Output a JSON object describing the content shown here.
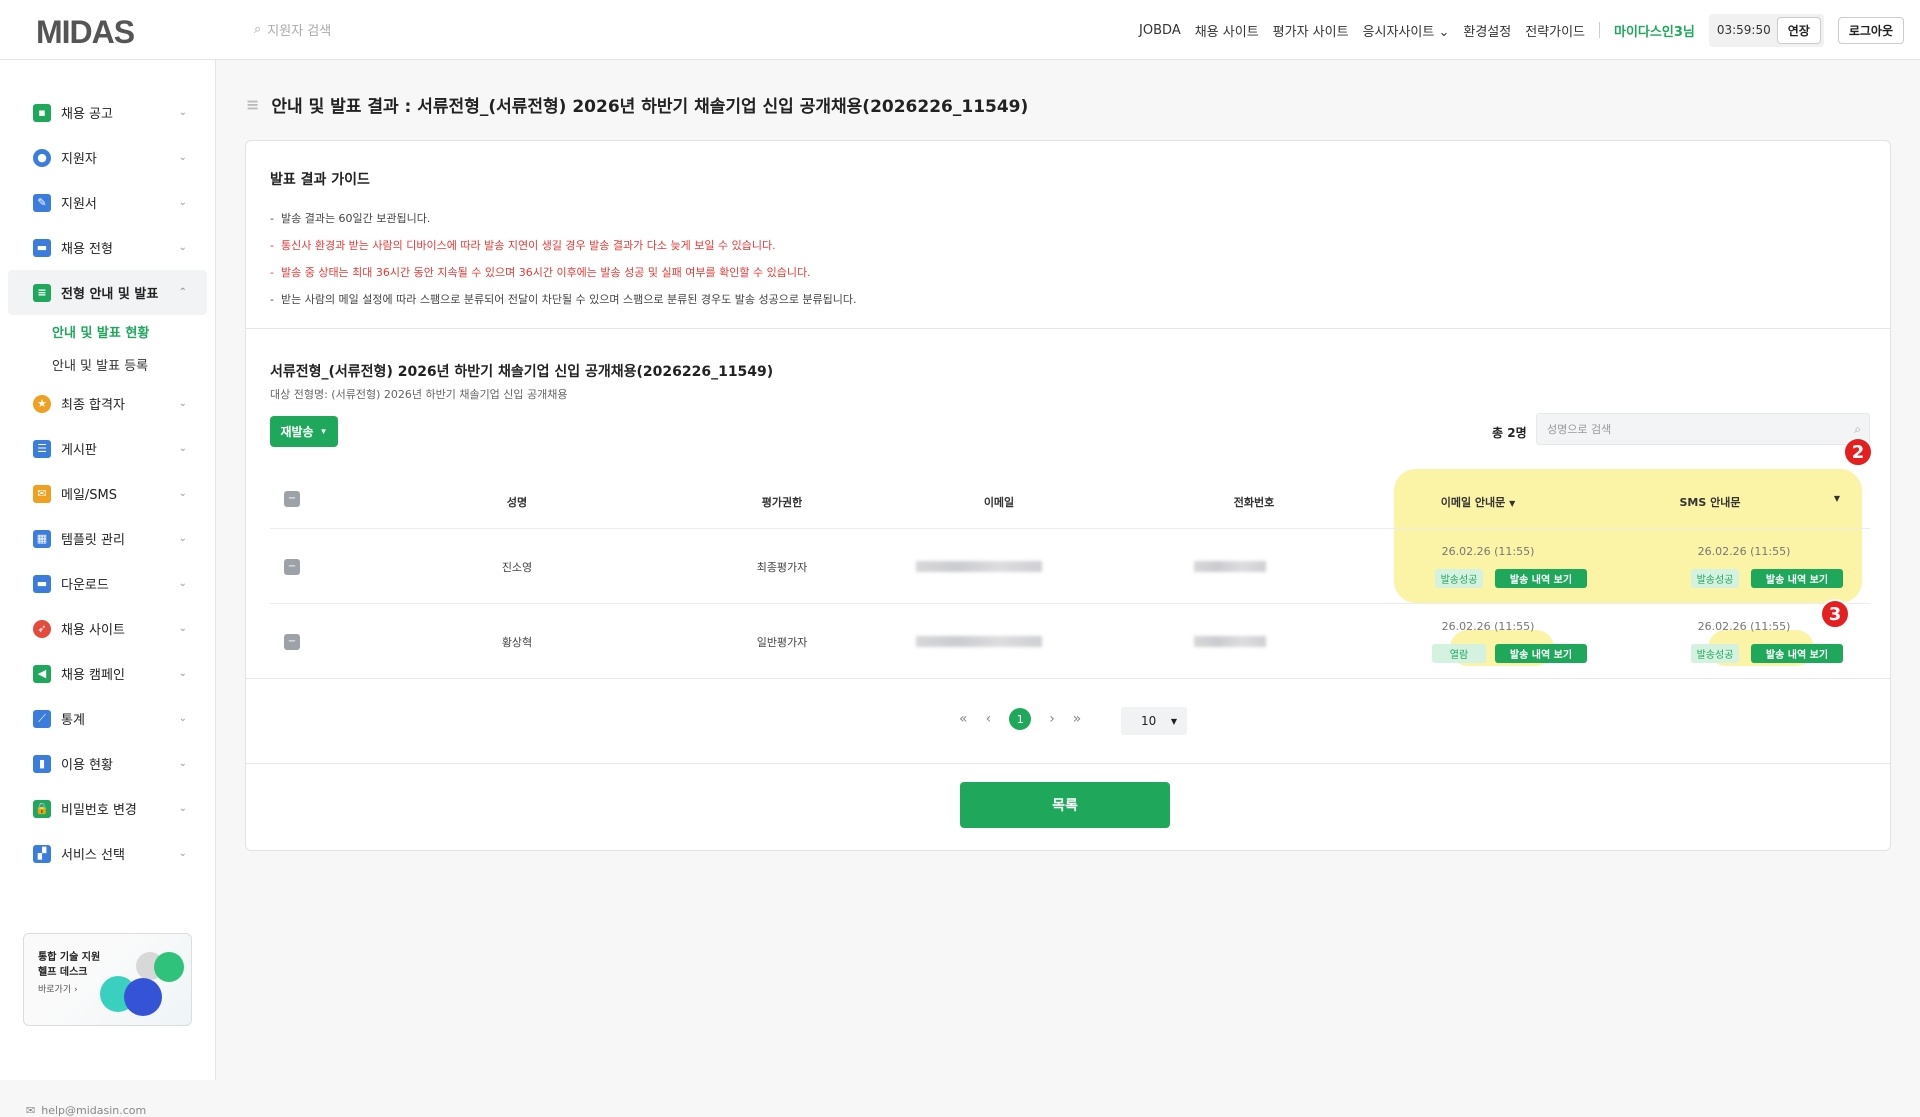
{
  "header": {
    "logo": "MIDAS",
    "search_placeholder": "지원자 검색",
    "nav": [
      "JOBDA",
      "채용 사이트",
      "평가자 사이트",
      "응시자사이트 ⌄",
      "환경설정",
      "전략가이드"
    ],
    "user": "마이다스인3님",
    "timer": "03:59:50",
    "extend": "연장",
    "logout": "로그아웃"
  },
  "sidebar": {
    "items": [
      {
        "label": "채용 공고",
        "icon": "briefcase-icon",
        "color": "#1fa85c"
      },
      {
        "label": "지원자",
        "icon": "person-icon",
        "color": "#3b7ddd"
      },
      {
        "label": "지원서",
        "icon": "document-icon",
        "color": "#3b7ddd"
      },
      {
        "label": "채용 전형",
        "icon": "folder-icon",
        "color": "#3b7ddd"
      },
      {
        "label": "전형 안내 및 발표",
        "icon": "notice-icon",
        "color": "#1fa85c"
      },
      {
        "label": "최종 합격자",
        "icon": "medal-icon",
        "color": "#f0a020"
      },
      {
        "label": "게시판",
        "icon": "board-icon",
        "color": "#3b7ddd"
      },
      {
        "label": "메일/SMS",
        "icon": "mail-icon",
        "color": "#f0a020"
      },
      {
        "label": "템플릿 관리",
        "icon": "template-icon",
        "color": "#3b7ddd"
      },
      {
        "label": "다운로드",
        "icon": "download-icon",
        "color": "#3b7ddd"
      },
      {
        "label": "채용 사이트",
        "icon": "rocket-icon",
        "color": "#e54a3c"
      },
      {
        "label": "채용 캠페인",
        "icon": "megaphone-icon",
        "color": "#1fa85c"
      },
      {
        "label": "통계",
        "icon": "stats-icon",
        "color": "#3b7ddd"
      },
      {
        "label": "이용 현황",
        "icon": "bar-chart-icon",
        "color": "#3b7ddd"
      },
      {
        "label": "비밀번호 변경",
        "icon": "lock-icon",
        "color": "#1fa85c"
      },
      {
        "label": "서비스 선택",
        "icon": "grid-icon",
        "color": "#3b7ddd"
      }
    ],
    "submenu": [
      "안내 및 발표 현황",
      "안내 및 발표 등록"
    ],
    "help_card": {
      "line1": "통합 기술 지원",
      "line2": "헬프 데스크",
      "link": "바로가기"
    },
    "help_email": "help@midasin.com"
  },
  "page": {
    "title": "안내 및 발표 결과 : 서류전형_(서류전형) 2026년 하반기 채솔기업 신입 공개채용(2026226_11549)",
    "guide_title": "발표 결과 가이드",
    "guide": [
      {
        "text": "발송 결과는 60일간 보관됩니다.",
        "red": false
      },
      {
        "text": "통신사 환경과 받는 사람의 디바이스에 따라 발송 지연이 생길 경우 발송 결과가 다소 늦게 보일 수 있습니다.",
        "red": true
      },
      {
        "text": "발송 중 상태는 최대 36시간 동안 지속될 수 있으며 36시간 이후에는 발송 성공 및 실패 여부를 확인할 수 있습니다.",
        "red": true
      },
      {
        "text": "받는 사람의 메일 설정에 따라 스팸으로 분류되어 전달이 차단될 수 있으며 스팸으로 분류된 경우도 발송 성공으로 분류됩니다.",
        "red": false
      }
    ],
    "section_title": "서류전형_(서류전형) 2026년 하반기 채솔기업 신입 공개채용(2026226_11549)",
    "section_sub": "대상 전형명: (서류전형) 2026년 하반기 채솔기업 신입 공개채용",
    "resend": "재발송",
    "total": "총 2명",
    "name_search_placeholder": "성명으로 검색",
    "columns": [
      "성명",
      "평가권한",
      "이메일",
      "전화번호",
      "이메일 안내문",
      "SMS 안내문"
    ],
    "rows": [
      {
        "name": "진소영",
        "role": "최종평가자",
        "email_time": "26.02.26 (11:55)",
        "email_status": "발송성공",
        "sms_time": "26.02.26 (11:55)",
        "sms_status": "발송성공"
      },
      {
        "name": "황상혁",
        "role": "일반평가자",
        "email_time": "26.02.26 (11:55)",
        "email_status": "열람",
        "sms_time": "26.02.26 (11:55)",
        "sms_status": "발송성공"
      }
    ],
    "view_history": "발송 내역 보기",
    "pagination": {
      "current": "1",
      "per_page": "10"
    },
    "list_button": "목록",
    "badges": [
      "2",
      "3"
    ]
  }
}
